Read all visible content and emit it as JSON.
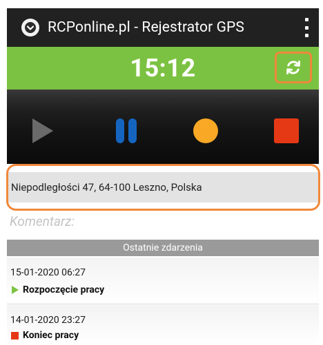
{
  "app": {
    "title": "RCPonline.pl - Rejestrator GPS",
    "logo_icon": "logo-icon",
    "menu_icon": "overflow-menu-icon"
  },
  "clock": {
    "time": "15:12",
    "refresh_icon": "refresh-icon"
  },
  "controls": {
    "play_icon": "play-icon",
    "pause_icon": "pause-icon",
    "record_icon": "record-icon",
    "stop_icon": "stop-icon"
  },
  "address": {
    "text": "Niepodległości 47, 64-100 Leszno, Polska"
  },
  "comment": {
    "placeholder": "Komentarz:"
  },
  "events": {
    "header": "Ostatnie zdarzenia",
    "items": [
      {
        "date": "15-01-2020 06:27",
        "label": "Rozpoczęcie pracy",
        "icon": "start-icon"
      },
      {
        "date": "14-01-2020 23:27",
        "label": "Koniec pracy",
        "icon": "stop-marker-icon"
      }
    ]
  },
  "colors": {
    "appbar": "#212121",
    "clockbar": "#7cc242",
    "highlight": "#f0883a",
    "pause": "#1565c0",
    "record": "#f9a825",
    "stop": "#e53916",
    "play": "#6a6a6a"
  }
}
